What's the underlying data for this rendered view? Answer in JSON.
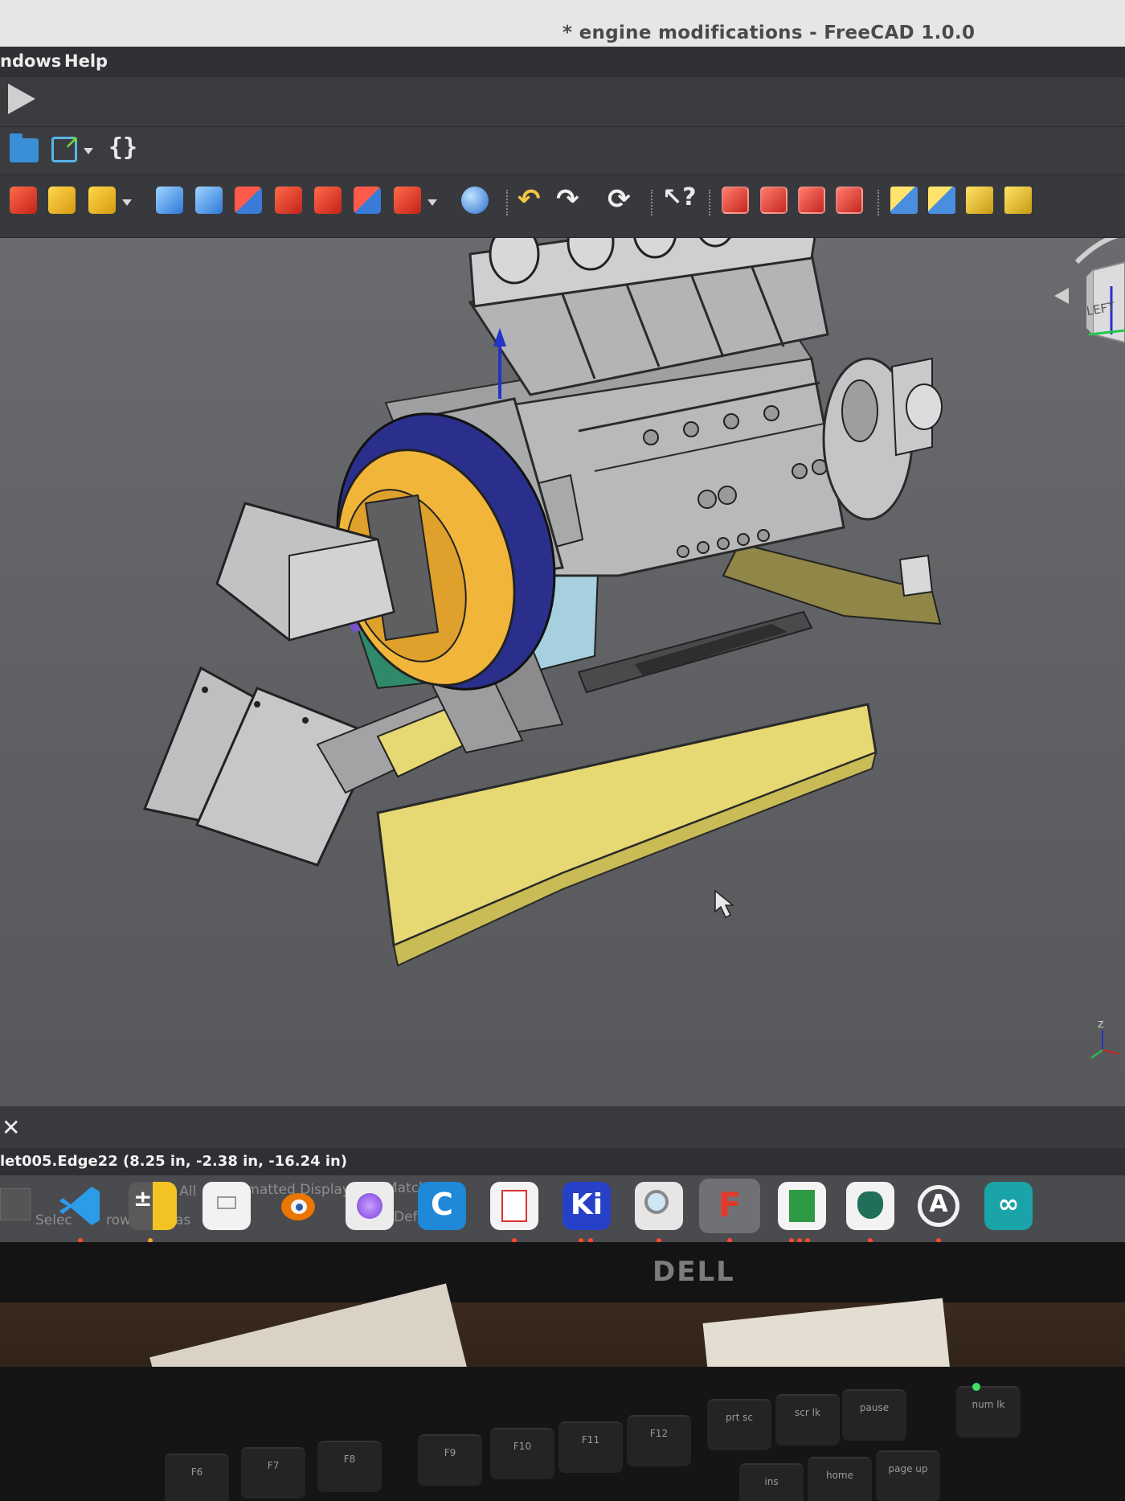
{
  "window": {
    "title": "* engine modifications - FreeCAD 1.0.0"
  },
  "menu": {
    "items": [
      "ndows",
      "Help"
    ]
  },
  "toolbar_row2": {
    "braces_label": "{}"
  },
  "navigation_cube": {
    "face_label": "LEFT"
  },
  "axis_indicator": {
    "z_label": "Z"
  },
  "status": {
    "selection": "let005.Edge22 (8.25 in, -2.38 in, -16.24 in)"
  },
  "find_bar": {
    "find_all": "Find All",
    "formatted_display": "Formatted Display",
    "match_case": "Match Case",
    "select": "Selec",
    "row": "row",
    "as": "as",
    "def": "Def"
  },
  "dock": {
    "kicad_label": "Ki",
    "freecad_label": "F"
  },
  "monitor": {
    "brand": "DELL"
  },
  "keyboard": {
    "keys": [
      "F6",
      "F7",
      "F8",
      "F9",
      "F10",
      "F11",
      "F12",
      "prt sc",
      "scr lk",
      "pause",
      "num lk",
      "ins",
      "home",
      "page up"
    ]
  },
  "colors": {
    "viewport_bg": "#5e5f62",
    "flywheel": "#f1b53a",
    "base_plate": "#e6d873",
    "part_grey": "#b9b9bb",
    "bracket_cyan": "#a6d0df",
    "plate_green": "#2f8a6a",
    "plate_purple": "#7a52c9"
  }
}
